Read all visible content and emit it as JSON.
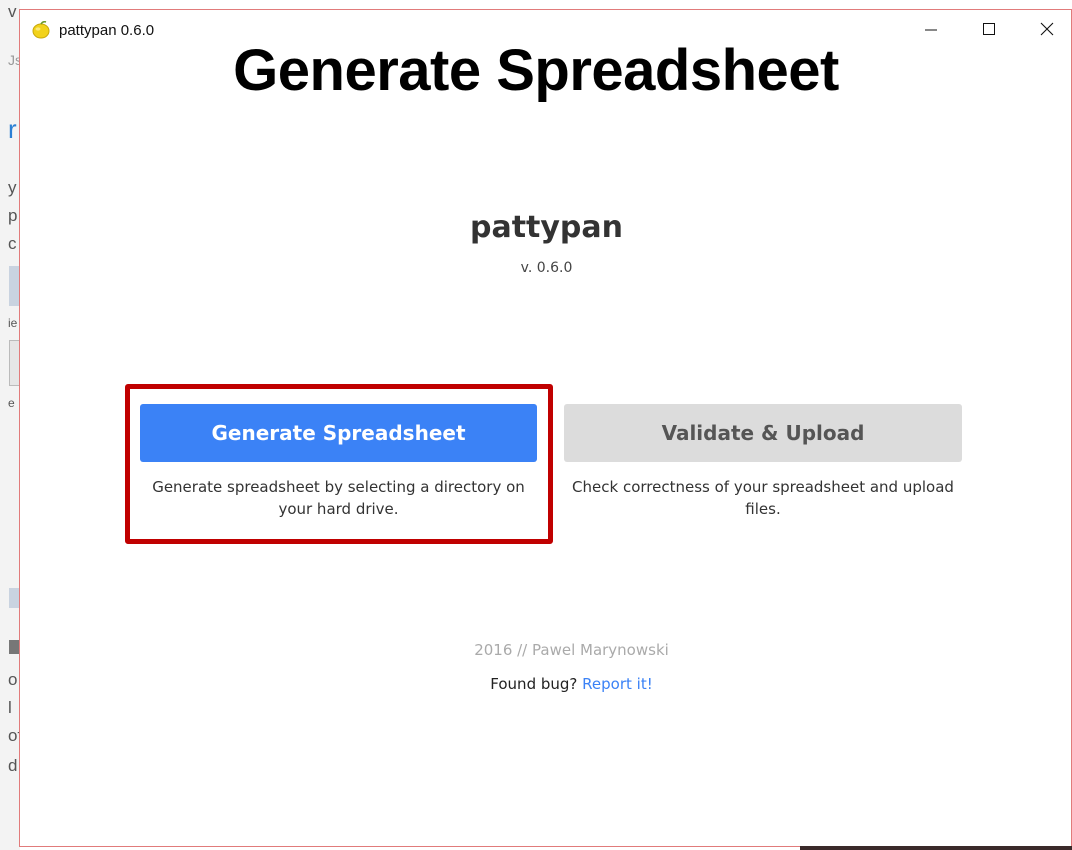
{
  "background_app": {
    "fragments": [
      "v",
      "Js",
      "r",
      "y",
      "p",
      "c",
      "ie",
      "e",
      "o",
      "l",
      "of",
      "d"
    ]
  },
  "window": {
    "title": "pattypan 0.6.0",
    "icon": "lemon-icon",
    "controls": {
      "minimize": "minimize-icon",
      "maximize": "maximize-icon",
      "close": "close-icon"
    }
  },
  "overlay_caption": "Generate Spreadsheet",
  "main": {
    "app_name": "pattypan",
    "version": "v. 0.6.0",
    "actions": [
      {
        "label": "Generate Spreadsheet",
        "description": "Generate spreadsheet by selecting a directory on your hard drive.",
        "color": "#3b82f6"
      },
      {
        "label": "Validate & Upload",
        "description": "Check correctness of your spreadsheet and upload files.",
        "color": "#dcdcdc"
      }
    ],
    "highlight_color": "#c00000"
  },
  "footer": {
    "credit": "2016 // Pawel Marynowski",
    "bug_prompt": "Found bug?",
    "bug_link": "Report it!"
  }
}
